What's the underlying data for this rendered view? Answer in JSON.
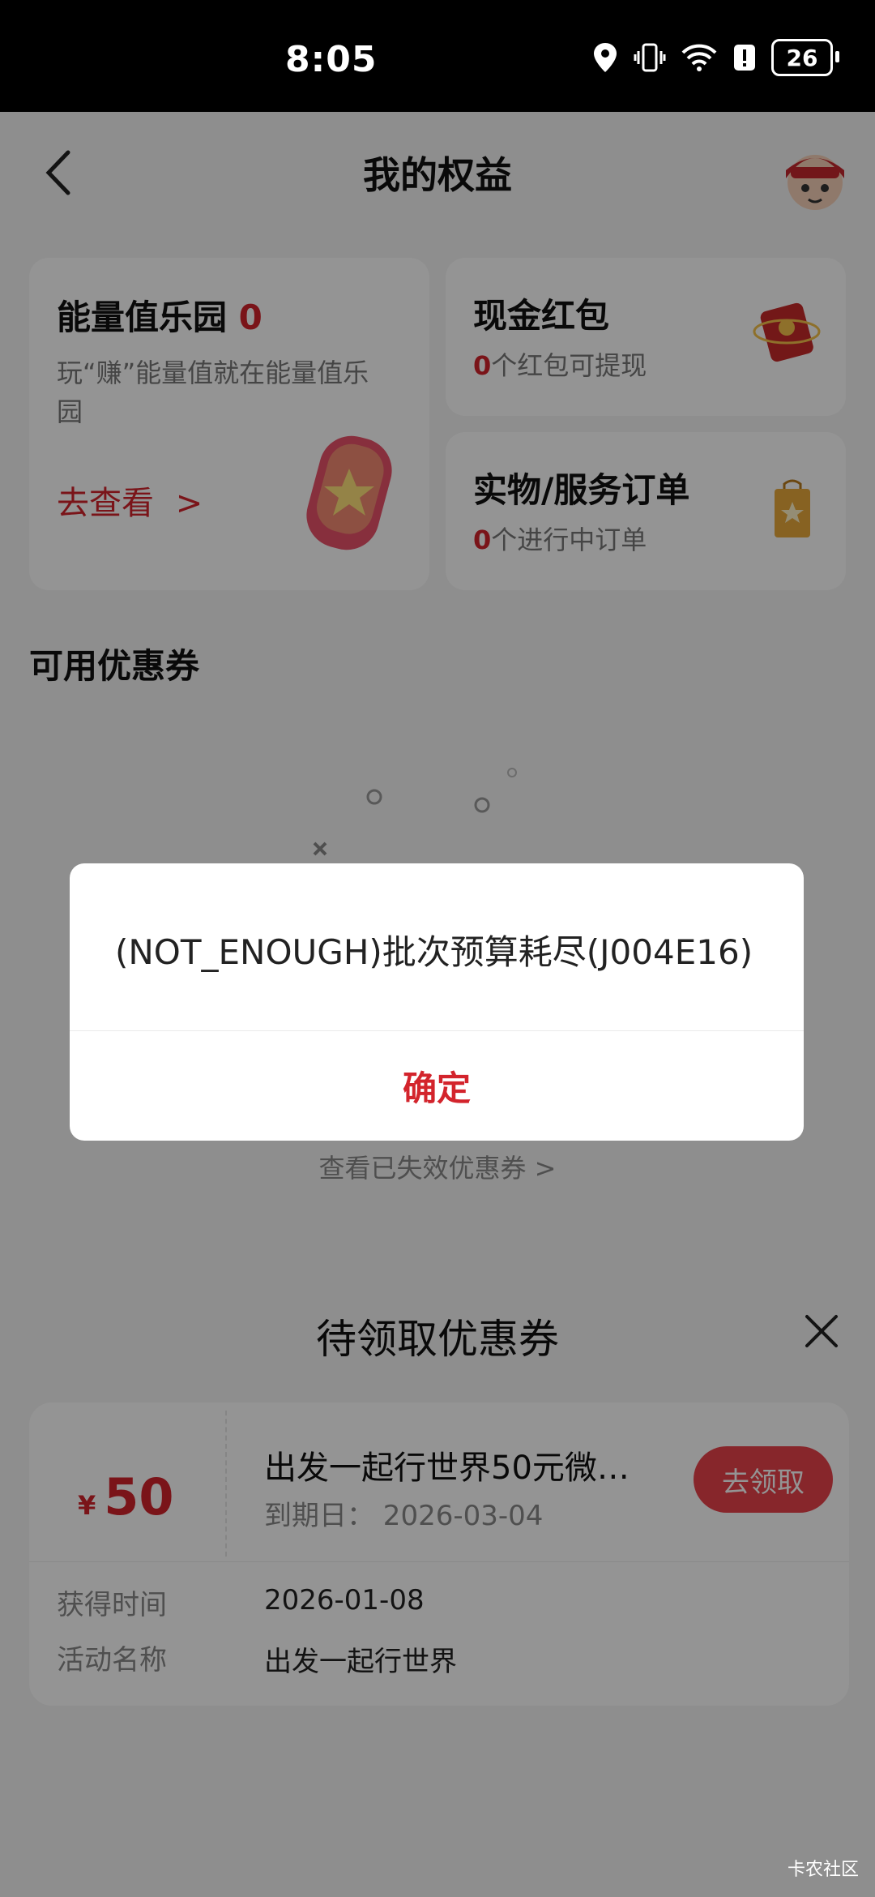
{
  "status_bar": {
    "time": "8:05",
    "battery": "26"
  },
  "header": {
    "title": "我的权益",
    "back_icon": "chevron-left-icon",
    "avatar_icon": "mascot-avatar-icon"
  },
  "energy_card": {
    "title": "能量值乐园",
    "value": "0",
    "description": "玩“赚”能量值就在能量值乐园",
    "link": "去查看",
    "link_arrow": ">"
  },
  "cash_card": {
    "title": "现金红包",
    "count": "0",
    "suffix": "个红包可提现"
  },
  "order_card": {
    "title": "实物/服务订单",
    "count": "0",
    "suffix": "个进行中订单"
  },
  "coupons": {
    "section_title": "可用优惠券",
    "expired_link": "查看已失效优惠券 >"
  },
  "dialog": {
    "message": "(NOT_ENOUGH)批次预算耗尽(J004E16)",
    "confirm": "确定"
  },
  "sheet": {
    "title": "待领取优惠券",
    "coupon": {
      "currency": "¥",
      "amount": "50",
      "name": "出发一起行世界50元微…",
      "expiry": "到期日：  2026-03-04",
      "claim_button": "去领取",
      "obtained_label": "获得时间",
      "obtained_value": "2026-01-08",
      "activity_label": "活动名称",
      "activity_value": "出发一起行世界"
    }
  },
  "watermark": "卡农社区",
  "colors": {
    "accent": "#d3242c",
    "button": "#e8424b"
  }
}
